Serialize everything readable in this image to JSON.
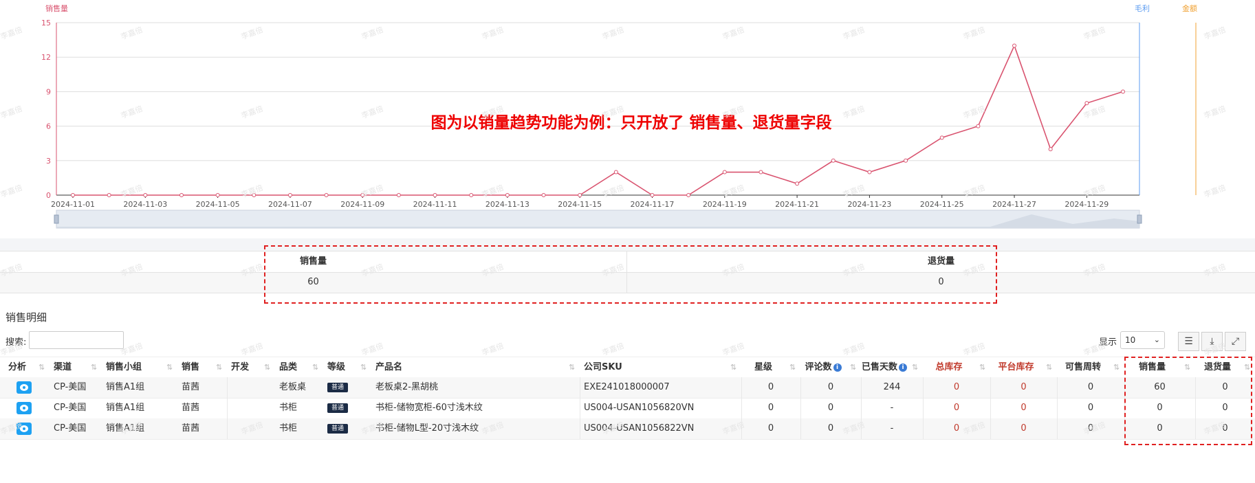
{
  "chart_data": {
    "type": "line",
    "title": "",
    "legend": [
      "销售量",
      "毛利",
      "金额"
    ],
    "legend_colors": {
      "销售量": "#d9536f",
      "毛利": "#5b9bf0",
      "金额": "#f0a030"
    },
    "ylim": [
      0,
      15
    ],
    "yticks": [
      0,
      3,
      6,
      9,
      12,
      15
    ],
    "xticks": [
      "2024-11-01",
      "2024-11-03",
      "2024-11-05",
      "2024-11-07",
      "2024-11-09",
      "2024-11-11",
      "2024-11-13",
      "2024-11-15",
      "2024-11-17",
      "2024-11-19",
      "2024-11-21",
      "2024-11-23",
      "2024-11-25",
      "2024-11-27",
      "2024-11-29"
    ],
    "series": [
      {
        "name": "销售量",
        "color": "#d9536f",
        "values": [
          0,
          0,
          0,
          0,
          0,
          0,
          0,
          0,
          0,
          0,
          0,
          0,
          0,
          0,
          0,
          2,
          0,
          0,
          2,
          2,
          1,
          3,
          2,
          3,
          5,
          6,
          13,
          4,
          8,
          9
        ]
      }
    ],
    "annotation": "图为以销量趋势功能为例：只开放了 销售量、退货量字段",
    "grid": true
  },
  "summary": {
    "headers": [
      "销售量",
      "退货量"
    ],
    "values": [
      "60",
      "0"
    ]
  },
  "detail": {
    "title": "销售明细",
    "search_label": "搜索:",
    "search_value": "",
    "show_label": "显示",
    "page_size": "10",
    "columns": [
      "分析",
      "渠道",
      "销售小组",
      "销售",
      "开发",
      "品类",
      "等级",
      "产品名",
      "公司SKU",
      "星级",
      "评论数",
      "已售天数",
      "总库存",
      "平台库存",
      "可售周转",
      "销售量",
      "退货量"
    ],
    "rows": [
      {
        "channel": "CP-美国",
        "group": "销售A1组",
        "sales": "苗茜",
        "dev": "",
        "category": "老板桌",
        "grade": "普通",
        "product": "老板桌2-黑胡桃",
        "sku": "EXE241018000007",
        "stars": "0",
        "reviews": "0",
        "days": "244",
        "total_stock": "0",
        "platform_stock": "0",
        "turnover": "0",
        "sales_qty": "60",
        "returns": "0"
      },
      {
        "channel": "CP-美国",
        "group": "销售A1组",
        "sales": "苗茜",
        "dev": "",
        "category": "书柜",
        "grade": "普通",
        "product": "书柜-储物宽柜-60寸浅木纹",
        "sku": "US004-USAN1056820VN",
        "stars": "0",
        "reviews": "0",
        "days": "-",
        "total_stock": "0",
        "platform_stock": "0",
        "turnover": "0",
        "sales_qty": "0",
        "returns": "0"
      },
      {
        "channel": "CP-美国",
        "group": "销售A1组",
        "sales": "苗茜",
        "dev": "",
        "category": "书柜",
        "grade": "普通",
        "product": "书柜-储物L型-20寸浅木纹",
        "sku": "US004-USAN1056822VN",
        "stars": "0",
        "reviews": "0",
        "days": "-",
        "total_stock": "0",
        "platform_stock": "0",
        "turnover": "0",
        "sales_qty": "0",
        "returns": "0"
      }
    ]
  },
  "watermark": "李嘉倍"
}
